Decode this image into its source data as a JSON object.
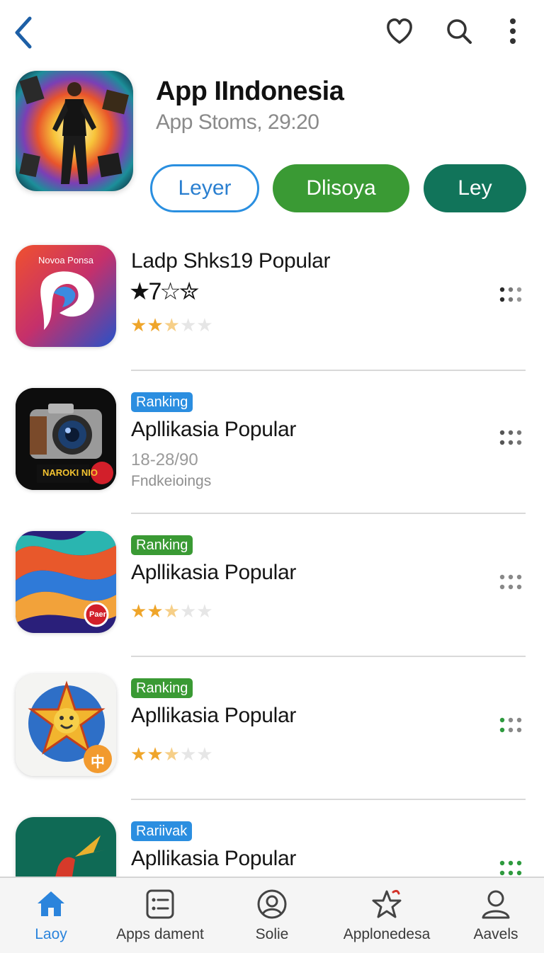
{
  "header": {
    "title": "App IIndonesia",
    "subtitle": "App Stoms, 29:20",
    "buttons": [
      {
        "label": "Leyer"
      },
      {
        "label": "Dlisoya"
      },
      {
        "label": "Ley"
      }
    ],
    "icons": {
      "back": "chevron-left-icon",
      "favorite": "heart-icon",
      "search": "search-icon",
      "more": "more-vertical-icon"
    }
  },
  "list": {
    "items": [
      {
        "icon_text": "Novoa Ponsa",
        "title": "Ladp Shks19 Popular",
        "stars_text": "★7☆✮",
        "rating": 2.5,
        "rating_max": 5
      },
      {
        "badge": "Ranking",
        "badge_color": "#2b8ee0",
        "title": "Apllikasia Popular",
        "meta": "18-28/90",
        "meta2": "Fndkeioings",
        "icon_sticker": "NAROKI NIO"
      },
      {
        "badge": "Ranking",
        "badge_color": "#3a9a34",
        "title": "Apllikasia Popular",
        "rating": 2.5,
        "rating_max": 5,
        "icon_sticker": "Paer"
      },
      {
        "badge": "Ranking",
        "badge_color": "#3a9a34",
        "title": "Apllikasia Popular",
        "rating": 2.5,
        "rating_max": 5,
        "icon_sticker": "中"
      },
      {
        "badge": "Rariivak",
        "badge_color": "#2b8ee0",
        "title": "Apllikasia Popular"
      }
    ]
  },
  "bottom_nav": {
    "items": [
      {
        "label": "Laoy",
        "icon": "home-icon",
        "active": true
      },
      {
        "label": "Apps dament",
        "icon": "list-icon",
        "active": false
      },
      {
        "label": "Solie",
        "icon": "profile-icon",
        "active": false
      },
      {
        "label": "Applonedesa",
        "icon": "star-icon",
        "active": false
      },
      {
        "label": "Aavels",
        "icon": "user-icon",
        "active": false
      }
    ]
  },
  "colors": {
    "accent_blue": "#2b84dc",
    "green": "#3a9a34",
    "teal": "#11745a",
    "star": "#efa52a"
  }
}
